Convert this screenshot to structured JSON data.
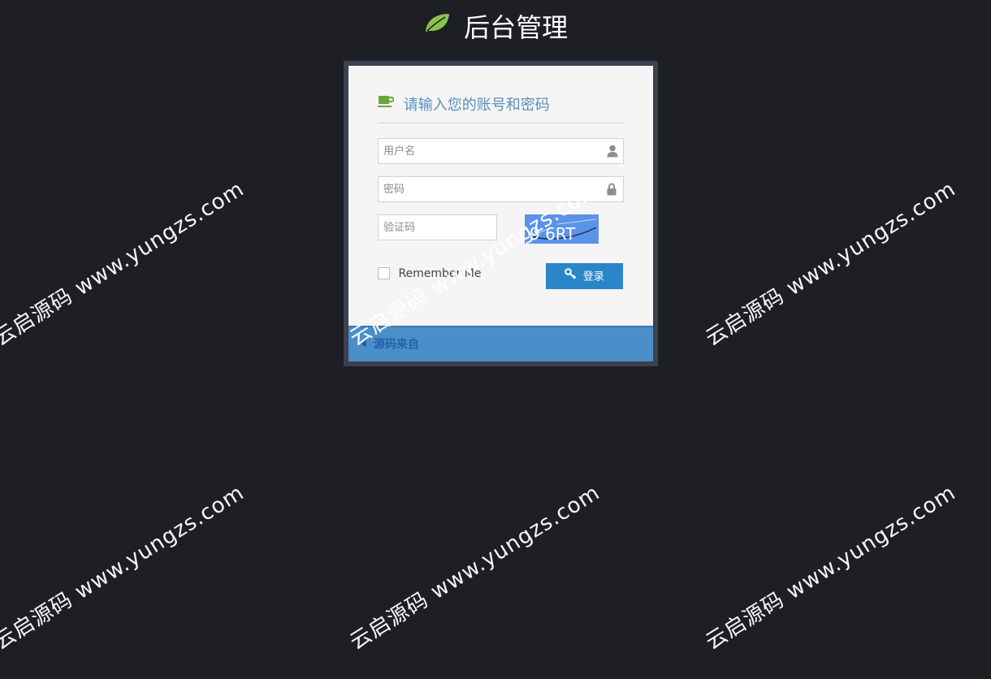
{
  "header": {
    "title": "后台管理",
    "leaf_icon": "leaf-icon",
    "leaf_color": "#8bc34a"
  },
  "login": {
    "heading": "请输入您的账号和密码",
    "heading_icon": "coffee-cup-icon",
    "heading_icon_color": "#6aa63b",
    "username": {
      "placeholder": "用户名",
      "value": "",
      "icon": "user-icon"
    },
    "password": {
      "placeholder": "密码",
      "value": "",
      "icon": "lock-icon"
    },
    "captcha": {
      "placeholder": "验证码",
      "value": "",
      "image_text": "9 6RT"
    },
    "remember_label": "Remember Me",
    "remember_checked": false,
    "submit_label": "登录",
    "submit_icon": "key-icon",
    "footer_link": "源码来自",
    "footer_icon": "arrow-left-icon"
  },
  "colors": {
    "page_background": "#1d1f24",
    "box_border": "#3b4151",
    "accent": "#2a86c9",
    "footer": "#4a8fc9"
  },
  "watermark_text": "云启源码 www.yungzs.com",
  "watermark_short": "云启源码",
  "watermark_domain_fragment": "yungzs.co"
}
